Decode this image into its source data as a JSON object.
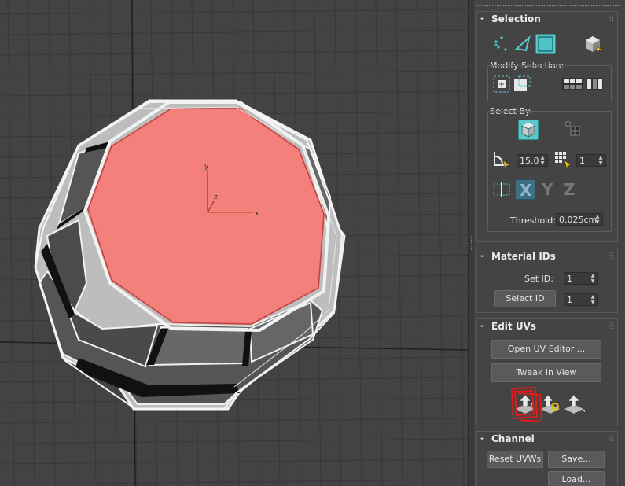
{
  "viewport": {
    "gizmo": {
      "x_label": "x",
      "y_label": "y",
      "z_label": "z"
    },
    "colors": {
      "background": "#434343",
      "grid": "#383838",
      "grid_dark": "#1f1f1f",
      "selected_face": "#f4807c",
      "wire": "#f2f2f2"
    }
  },
  "panel": {
    "selection": {
      "sign": "-",
      "title": "Selection",
      "icons": [
        "vertex-icon",
        "edge-icon",
        "polygon-icon",
        "element-icon"
      ],
      "modify_selection": {
        "label": "Modify Selection:",
        "icons": [
          "grow-selection-icon",
          "shrink-selection-icon",
          "loop-icon",
          "ring-icon"
        ]
      },
      "select_by": {
        "label": "Select By:",
        "element_icon": "select-element-icon",
        "pattern_icon": "select-pattern-icon",
        "angle_value": "15.0",
        "grid_value": "1",
        "axis_labels": [
          "X",
          "Y",
          "Z"
        ],
        "threshold_label": "Threshold:",
        "threshold_value": "0.025cm"
      }
    },
    "material_ids": {
      "sign": "-",
      "title": "Material IDs",
      "set_id_label": "Set ID:",
      "set_id_value": "1",
      "select_id_button": "Select ID",
      "select_id_value": "1"
    },
    "edit_uvs": {
      "sign": "-",
      "title": "Edit UVs",
      "open_editor_button": "Open UV Editor ...",
      "tweak_button": "Tweak In View",
      "tool_icons": [
        "quick-planar-map-icon",
        "quick-peel-icon",
        "unfold-icon"
      ],
      "annotation_color": "#e31b1b"
    },
    "channel": {
      "sign": "-",
      "title": "Channel",
      "reset_button": "Reset UVWs",
      "save_button": "Save...",
      "load_button": "Load..."
    }
  }
}
